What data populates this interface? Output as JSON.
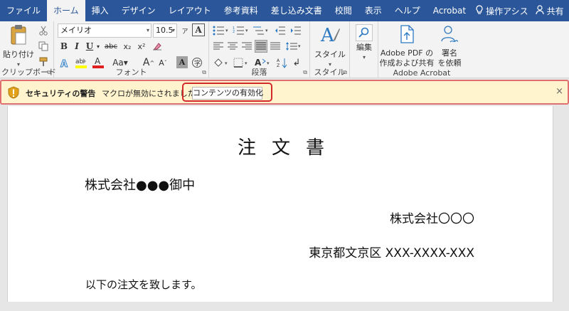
{
  "tabs": [
    {
      "label": "ファイル",
      "active": false
    },
    {
      "label": "ホーム",
      "active": true
    },
    {
      "label": "挿入",
      "active": false
    },
    {
      "label": "デザイン",
      "active": false
    },
    {
      "label": "レイアウト",
      "active": false
    },
    {
      "label": "参考資料",
      "active": false
    },
    {
      "label": "差し込み文書",
      "active": false
    },
    {
      "label": "校閲",
      "active": false
    },
    {
      "label": "表示",
      "active": false
    },
    {
      "label": "ヘルプ",
      "active": false
    },
    {
      "label": "Acrobat",
      "active": false
    }
  ],
  "tell_me": {
    "label": "操作アシス",
    "icon": "lightbulb-icon"
  },
  "share": {
    "label": "共有",
    "icon": "person-icon"
  },
  "ribbon": {
    "clipboard": {
      "paste_label": "貼り付け",
      "group_label": "クリップボード"
    },
    "font": {
      "font_name": "メイリオ",
      "font_size": "10.5",
      "group_label": "フォント"
    },
    "paragraph": {
      "group_label": "段落"
    },
    "styles": {
      "button_label": "スタイル",
      "group_label": "スタイル"
    },
    "editing": {
      "button_label": "編集"
    },
    "acrobat": {
      "create_pdf_line1": "Adobe PDF の",
      "create_pdf_line2": "作成および共有",
      "sign_line1": "署名",
      "sign_line2": "を依頼",
      "group_label": "Adobe Acrobat"
    }
  },
  "security_bar": {
    "title": "セキュリティの警告",
    "message": "マクロが無効にされました。",
    "button_label": "コンテンツの有効化",
    "close": "×",
    "highlight_color": "#d22a2a",
    "background": "#fff4ce"
  },
  "document": {
    "title": "注文書",
    "addressee": "株式会社●●●御中",
    "sender": "株式会社〇〇〇",
    "address": "東京都文京区 XXX-XXXX-XXX",
    "body": "以下の注文を致します。"
  },
  "colors": {
    "accent": "#2b579a",
    "ribbon_bg": "#f3f3f3"
  }
}
